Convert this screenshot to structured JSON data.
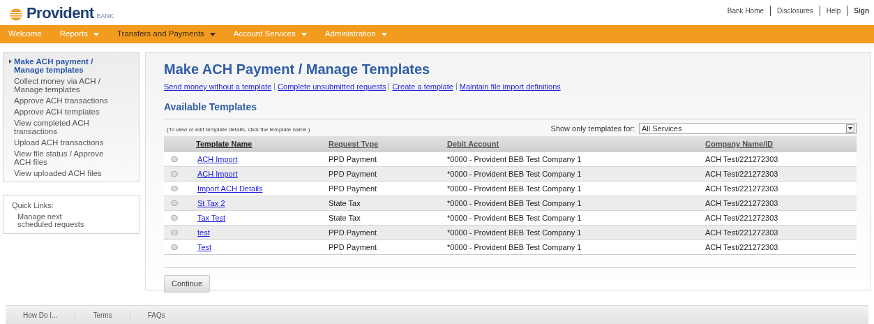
{
  "header": {
    "logo": {
      "name": "Provident",
      "suffix": "BANK"
    },
    "links": [
      "Bank Home",
      "Disclosures",
      "Help",
      "Sign"
    ]
  },
  "nav": [
    {
      "label": "Welcome",
      "dropdown": false,
      "selected": false
    },
    {
      "label": "Reports",
      "dropdown": true,
      "selected": false
    },
    {
      "label": "Transfers and Payments",
      "dropdown": true,
      "selected": true
    },
    {
      "label": "Account Services",
      "dropdown": true,
      "selected": false
    },
    {
      "label": "Administration",
      "dropdown": true,
      "selected": false
    }
  ],
  "sidebar": {
    "items": [
      {
        "label": "Make ACH payment / Manage templates",
        "selected": true
      },
      {
        "label": "Collect money via ACH / Manage templates",
        "selected": false
      },
      {
        "label": "Approve ACH transactions",
        "selected": false
      },
      {
        "label": "Approve ACH templates",
        "selected": false
      },
      {
        "label": "View completed ACH transactions",
        "selected": false
      },
      {
        "label": "Upload ACH transactions",
        "selected": false
      },
      {
        "label": "View file status / Approve ACH files",
        "selected": false
      },
      {
        "label": "View uploaded ACH files",
        "selected": false
      }
    ],
    "quick_links": {
      "title": "Quick Links:",
      "items": [
        "Manage next scheduled requests"
      ]
    }
  },
  "page": {
    "title": "Make ACH Payment / Manage Templates",
    "links": [
      "Send money without a template",
      "Complete unsubmitted requests",
      "Create a template",
      "Maintain file import definitions"
    ],
    "section_title": "Available Templates",
    "hint": "(To view or edit template details, click the template name.)",
    "filter": {
      "label": "Show only templates for:",
      "value": "All Services"
    },
    "table": {
      "columns": [
        "Template Name",
        "Request Type",
        "Debit Account",
        "Company Name/ID"
      ],
      "rows": [
        {
          "selected": false,
          "cells": [
            "ACH Import",
            "PPD Payment",
            "*0000 - Provident BEB Test Company 1",
            "ACH Test/221272303"
          ]
        },
        {
          "selected": false,
          "cells": [
            "ACH Import",
            "PPD Payment",
            "*0000 - Provident BEB Test Company 1",
            "ACH Test/221272303"
          ]
        },
        {
          "selected": false,
          "cells": [
            "Import ACH Details",
            "PPD Payment",
            "*0000 - Provident BEB Test Company 1",
            "ACH Test/221272303"
          ]
        },
        {
          "selected": false,
          "cells": [
            "St Tax 2",
            "State Tax",
            "*0000 - Provident BEB Test Company 1",
            "ACH Test/221272303"
          ]
        },
        {
          "selected": false,
          "cells": [
            "Tax Test",
            "State Tax",
            "*0000 - Provident BEB Test Company 1",
            "ACH Test/221272303"
          ]
        },
        {
          "selected": false,
          "cells": [
            "test",
            "PPD Payment",
            "*0000 - Provident BEB Test Company 1",
            "ACH Test/221272303"
          ]
        },
        {
          "selected": false,
          "cells": [
            "Test",
            "PPD Payment",
            "*0000 - Provident BEB Test Company 1",
            "ACH Test/221272303"
          ]
        }
      ]
    },
    "button": "Continue"
  },
  "footer": [
    "How Do I...",
    "Terms",
    "FAQs"
  ]
}
